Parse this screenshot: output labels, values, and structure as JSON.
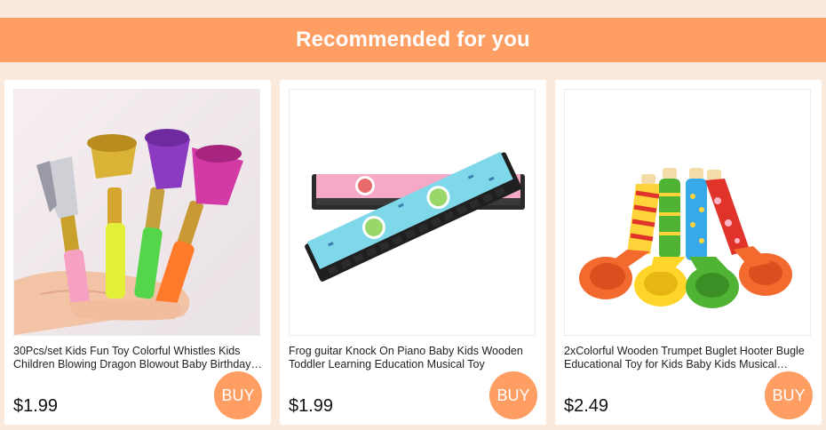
{
  "header": {
    "title": "Recommended for you"
  },
  "products": [
    {
      "title": "30Pcs/set Kids Fun Toy Colorful Whistles Kids Children Blowing Dragon Blowout Baby Birthday Party",
      "price": "$1.99",
      "buy_label": "BUY",
      "image": "party-blowout-whistles"
    },
    {
      "title": "Frog guitar Knock On Piano Baby Kids Wooden Toddler Learning Education Musical Toy",
      "price": "$1.99",
      "buy_label": "BUY",
      "image": "harmonicas"
    },
    {
      "title": "2xColorful Wooden Trumpet Buglet Hooter Bugle Educational Toy for Kids Baby Kids Musical Instrument",
      "price": "$2.49",
      "buy_label": "BUY",
      "image": "wooden-trumpets"
    }
  ],
  "colors": {
    "accent": "#ff9e63",
    "page_background": "#fbe9dc",
    "card_background": "#ffffff"
  }
}
